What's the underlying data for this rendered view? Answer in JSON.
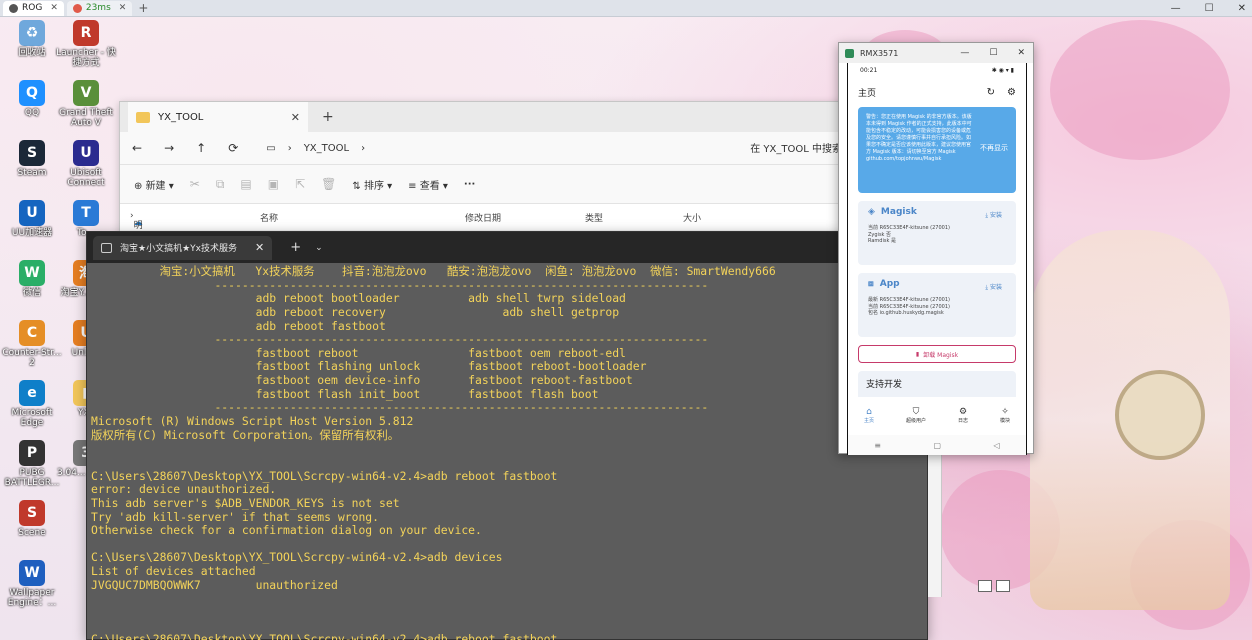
{
  "browser": {
    "tab1_title": "ROG",
    "tab2_ping": "23ms",
    "close_glyph": "✕",
    "add_glyph": "+"
  },
  "window_controls": [
    "—",
    "☐",
    "✕"
  ],
  "desktop_icons": [
    {
      "label": "回收站",
      "color": "#6fa8dc",
      "glyph": "♻"
    },
    {
      "label": "Launcher - 快捷方式",
      "color": "#c0392b",
      "glyph": "R"
    },
    {
      "label": "QQ",
      "color": "#1e90ff",
      "glyph": "Q"
    },
    {
      "label": "Grand Theft Auto V",
      "color": "#5a8f3a",
      "glyph": "V"
    },
    {
      "label": "Steam",
      "color": "#1b2838",
      "glyph": "S"
    },
    {
      "label": "Ubisoft Connect",
      "color": "#2b2b8f",
      "glyph": "U"
    },
    {
      "label": "UU加速器",
      "color": "#1565c0",
      "glyph": "U"
    },
    {
      "label": "To...",
      "color": "#2a7ad6",
      "glyph": "T"
    },
    {
      "label": "微信",
      "color": "#2aae67",
      "glyph": "W"
    },
    {
      "label": "淘宝Y... 兑...",
      "color": "#e67e22",
      "glyph": "淘"
    },
    {
      "label": "Counter-Str... 2",
      "color": "#e58e26",
      "glyph": "C"
    },
    {
      "label": "Unlo...",
      "color": "#e67e22",
      "glyph": "U"
    },
    {
      "label": "Microsoft Edge",
      "color": "#0f7fc9",
      "glyph": "e"
    },
    {
      "label": "YX_",
      "color": "#f2c65a",
      "glyph": "▮"
    },
    {
      "label": "PUBG BATTLEGR...",
      "color": "#333333",
      "glyph": "P"
    },
    {
      "label": "3.04... 远控...",
      "color": "#777777",
      "glyph": "3"
    },
    {
      "label": "Scene",
      "color": "#c0392b",
      "glyph": "S"
    },
    {
      "label": "Wallpaper Engine：...",
      "color": "#1f5fbf",
      "glyph": "W"
    }
  ],
  "explorer": {
    "tab_title": "YX_TOOL",
    "path": "YX_TOOL",
    "search_placeholder": "在 YX_TOOL 中搜索",
    "toolbar": {
      "new": "新建",
      "sort": "排序",
      "view": "查看",
      "more": "···"
    },
    "sidebar_item": "明宇 - 个人",
    "columns": [
      "名称",
      "修改日期",
      "类型",
      "大小"
    ]
  },
  "terminal": {
    "tab_title": "淘宝★小文搞机★Yx技术服务",
    "lines": [
      {
        "t": "          淘宝:小文搞机   Yx技术服务    抖音:泡泡龙ovo   酷安:泡泡龙ovo  闲鱼: 泡泡龙ovo  微信: SmartWendy666",
        "c": "y"
      },
      {
        "t": "                  ------------------------------------------------------------------------",
        "c": "y"
      },
      {
        "t": "                        adb reboot bootloader          adb shell twrp sideload",
        "c": "y"
      },
      {
        "t": "                        adb reboot recovery                 adb shell getprop",
        "c": "y"
      },
      {
        "t": "                        adb reboot fastboot",
        "c": "y"
      },
      {
        "t": "                  ------------------------------------------------------------------------",
        "c": "y"
      },
      {
        "t": "                        fastboot reboot                fastboot oem reboot-edl",
        "c": "y"
      },
      {
        "t": "                        fastboot flashing unlock       fastboot reboot-bootloader",
        "c": "y"
      },
      {
        "t": "                        fastboot oem device-info       fastboot reboot-fastboot",
        "c": "y"
      },
      {
        "t": "                        fastboot flash init_boot       fastboot flash boot",
        "c": "y"
      },
      {
        "t": "                  ------------------------------------------------------------------------",
        "c": "y"
      },
      {
        "t": "Microsoft (R) Windows Script Host Version 5.812",
        "c": "y"
      },
      {
        "t": "版权所有(C) Microsoft Corporation。保留所有权利。",
        "c": "y"
      },
      {
        "t": "",
        "c": "y"
      },
      {
        "t": "",
        "c": "y"
      },
      {
        "t": "C:\\Users\\28607\\Desktop\\YX_TOOL\\Scrcpy-win64-v2.4>adb reboot fastboot",
        "c": "y"
      },
      {
        "t": "error: device unauthorized.",
        "c": "y"
      },
      {
        "t": "This adb server's $ADB_VENDOR_KEYS is not set",
        "c": "y"
      },
      {
        "t": "Try 'adb kill-server' if that seems wrong.",
        "c": "y"
      },
      {
        "t": "Otherwise check for a confirmation dialog on your device.",
        "c": "y"
      },
      {
        "t": "",
        "c": "y"
      },
      {
        "t": "C:\\Users\\28607\\Desktop\\YX_TOOL\\Scrcpy-win64-v2.4>adb devices",
        "c": "y"
      },
      {
        "t": "List of devices attached",
        "c": "y"
      },
      {
        "t": "JVGQUC7DMBQOWWK7        unauthorized",
        "c": "y"
      },
      {
        "t": "",
        "c": "y"
      },
      {
        "t": "",
        "c": "y"
      },
      {
        "t": "",
        "c": "y"
      },
      {
        "t": "C:\\Users\\28607\\Desktop\\YX_TOOL\\Scrcpy-win64-v2.4>adb reboot fastboot",
        "c": "y"
      }
    ]
  },
  "phone_window": {
    "title": "RMX3571",
    "status_time": "00:21",
    "status_icons": "✱ ◉ ▾ ▮",
    "page_title": "主页",
    "notice": "警告：您正在使用 Magisk 的非官方版本。该版本未得到 Magisk 作者的正式支持，此版本中可能包含不稳定的改动，可能会损害您的设备或危及您的安全。请您谨慎行事并自行承担风险。如果您不确定是否应该使用此版本，建议您使用官方 Magisk 版本：请切换至官方 Magisk github.com/topjohnwu/Magisk",
    "notice_btn": "不再显示",
    "magisk": {
      "title": "Magisk",
      "action": "安装",
      "info": [
        "当前 R65C33E4F-kitsune (27001)",
        "Zygisk  否",
        "Ramdisk  是"
      ]
    },
    "app": {
      "title": "App",
      "action": "安装",
      "info": [
        "最新 R65C33E4F-kitsune (27001)",
        "当前 R65C33E4F-kitsune (27001)",
        "包名 io.github.huskydg.magisk"
      ]
    },
    "uninstall": "卸载 Magisk",
    "support": "支持开发",
    "nav": [
      {
        "icon": "⌂",
        "label": "主页"
      },
      {
        "icon": "⛉",
        "label": "超级用户"
      },
      {
        "icon": "⚙",
        "label": "日志"
      },
      {
        "icon": "✧",
        "label": "模块"
      }
    ],
    "sysnav": [
      "≡",
      "▢",
      "◁"
    ]
  }
}
